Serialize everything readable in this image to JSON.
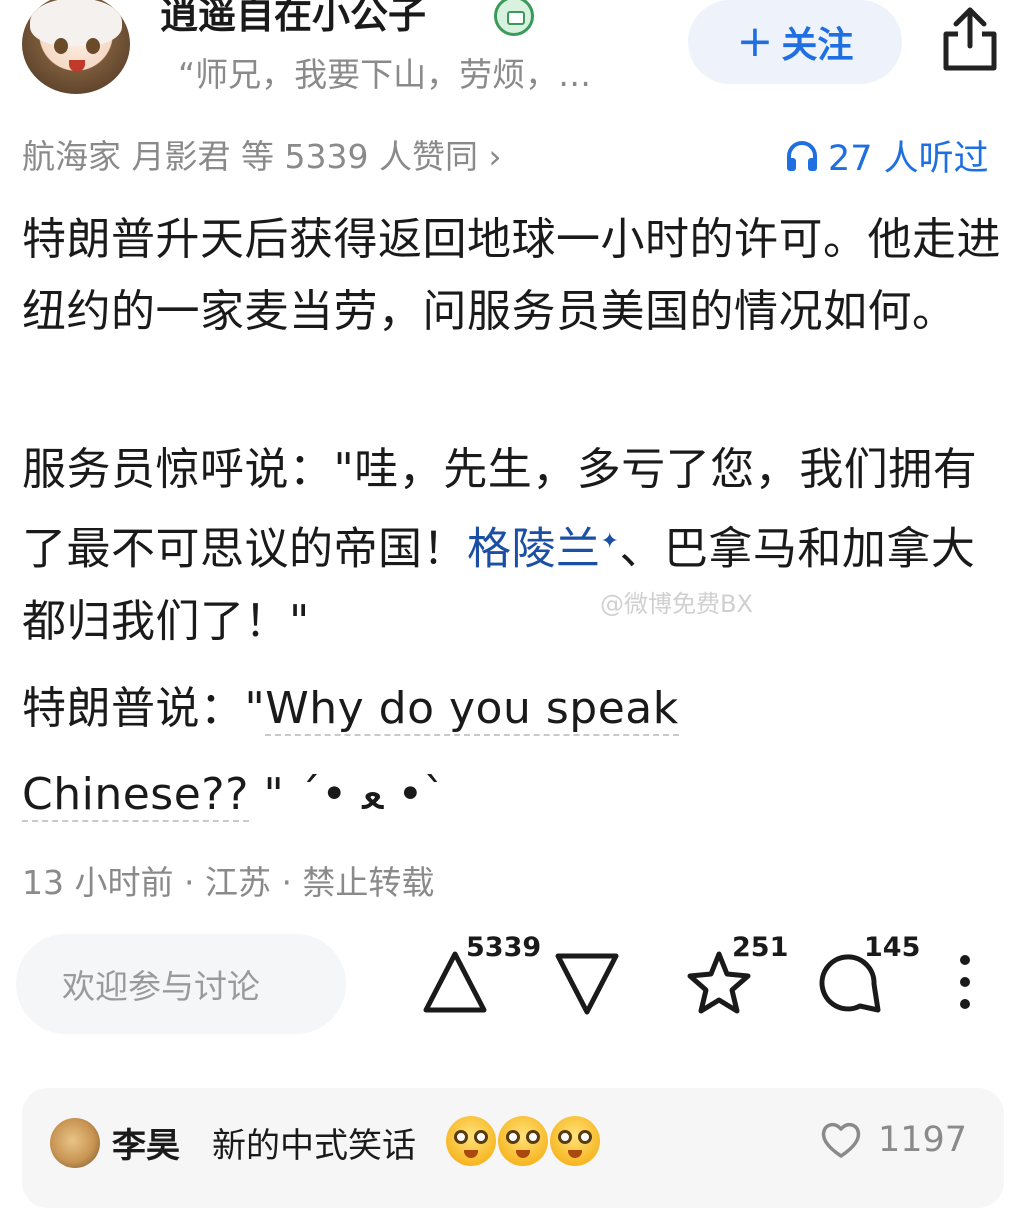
{
  "header": {
    "author_name": "逍遥自在小公子",
    "author_bio": "“师兄，我要下山，劳烦，…",
    "follow_plus": "+",
    "follow_label": "关注",
    "avatar_icon": "anime-avatar",
    "badge_icon": "green-badge-icon",
    "share_icon": "share-icon"
  },
  "meta": {
    "approval_text": "航海家 月影君 等 5339 人赞同 ›",
    "listen_text": "27 人听过",
    "listen_icon": "headphones-icon"
  },
  "content": {
    "p1": "特朗普升天后获得返回地球一小时的许可。他走进纽约的一家麦当劳，问服务员美国的情况如何。",
    "p2_before": "服务员惊呼说：\"哇，先生，多亏了您，我们拥有了最不可思议的帝国！",
    "p2_link": "格陵兰",
    "p2_after": "、巴拿马和加拿大都归我们了！\"",
    "p3_before": "特朗普说：\"",
    "p3_dotted1": "Why do you speak",
    "p3_dotted2": "Chinese??",
    "p3_after": " \" ´• ﻌ •`",
    "watermark": "@微博免费BX"
  },
  "time_line": "13 小时前 · 江苏 · 禁止转载",
  "actions": {
    "comment_placeholder": "欢迎参与讨论",
    "upvote_count": "5339",
    "favorite_count": "251",
    "comment_count": "145"
  },
  "top_comment": {
    "name": "李昊",
    "text": "新的中式笑话",
    "emoji": "flushed-face-emoji",
    "likes": "1197"
  },
  "colors": {
    "accent": "#1f6fe0",
    "link": "#1a4fa3",
    "muted": "#8a8a8a"
  }
}
